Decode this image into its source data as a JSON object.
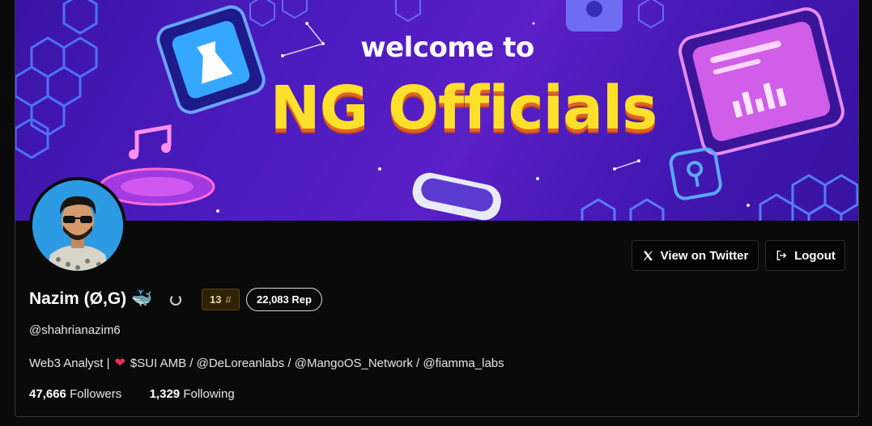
{
  "banner": {
    "line1": "welcome to",
    "line2": "NG Officials"
  },
  "profile": {
    "display_name": "Nazim (Ø,G) 🐳",
    "handle": "@shahrianazim6",
    "bio_prefix": "Web3 Analyst |",
    "bio_suffix": "$SUI AMB / @DeLoreanlabs / @MangoOS_Network / @fiamma_labs",
    "rank": "13",
    "rank_symbol": "#",
    "reputation": "22,083 Rep",
    "followers_count": "47,666",
    "followers_label": "Followers",
    "following_count": "1,329",
    "following_label": "Following"
  },
  "actions": {
    "twitter_label": "View on Twitter",
    "logout_label": "Logout"
  },
  "colors": {
    "background": "#0a0a0b",
    "banner_purple": "#4d1cc0",
    "banner_title": "#fde02a",
    "heart": "#e8315a"
  }
}
